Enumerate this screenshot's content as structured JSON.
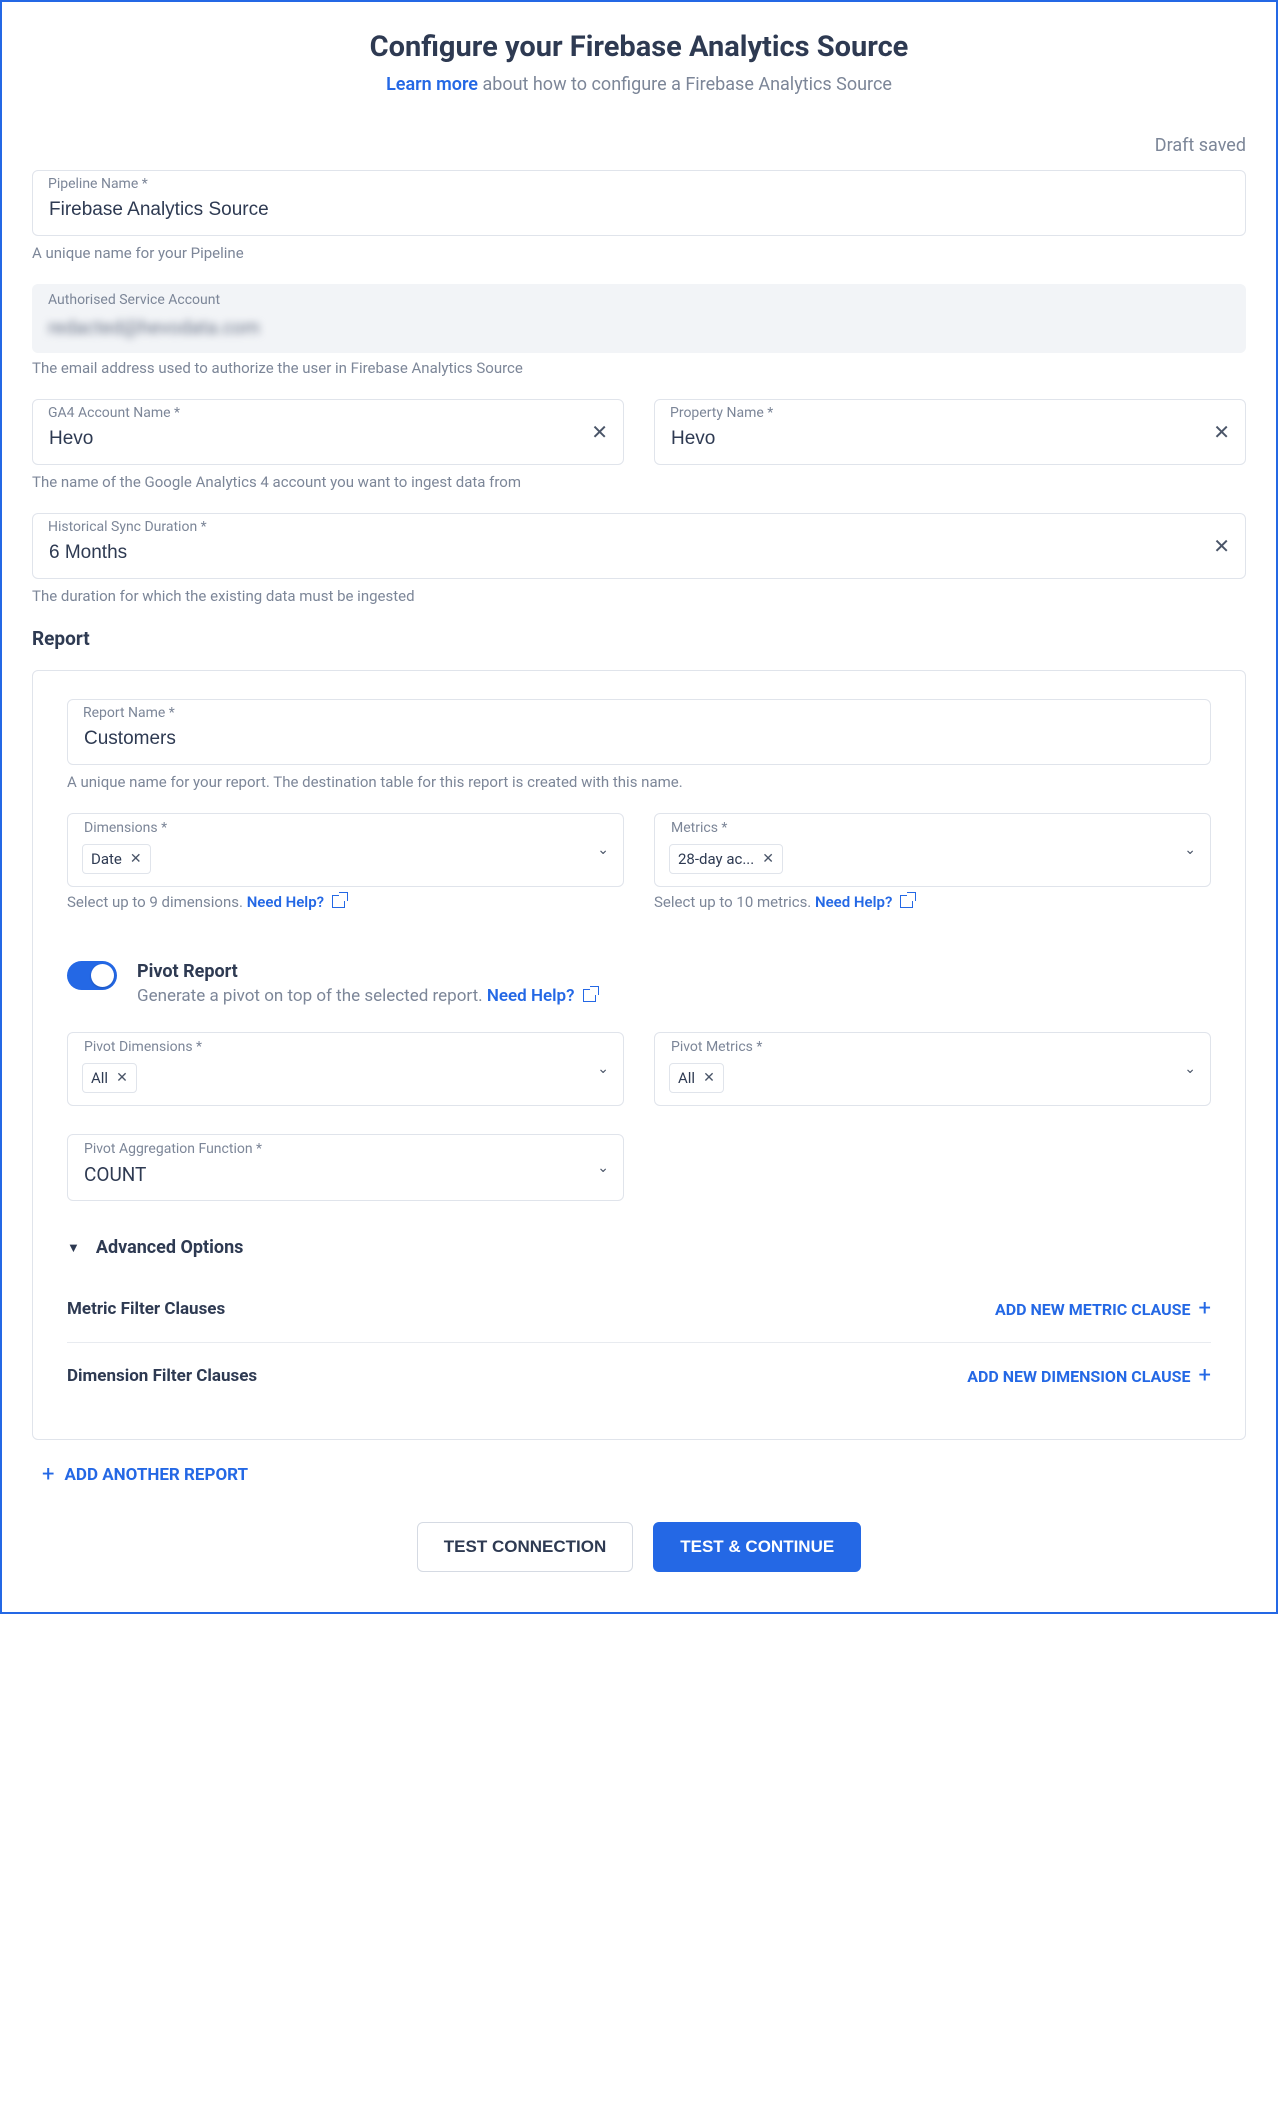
{
  "header": {
    "title": "Configure your Firebase Analytics Source",
    "learn_more": "Learn more",
    "subtitle_rest": " about how to configure a Firebase Analytics Source"
  },
  "status": "Draft saved",
  "fields": {
    "pipeline_name": {
      "label": "Pipeline Name *",
      "value": "Firebase Analytics Source",
      "helper": "A unique name for your Pipeline"
    },
    "service_account": {
      "label": "Authorised Service Account",
      "value": "redacted@hevodata.com",
      "helper": "The email address used to authorize the user in Firebase Analytics Source"
    },
    "ga4_account": {
      "label": "GA4 Account Name *",
      "value": "Hevo",
      "helper": "The name of the Google Analytics 4 account you want to ingest data from"
    },
    "property": {
      "label": "Property Name *",
      "value": "Hevo"
    },
    "sync_duration": {
      "label": "Historical Sync Duration *",
      "value": "6 Months",
      "helper": "The duration for which the existing data must be ingested"
    }
  },
  "report_section": "Report",
  "report": {
    "name": {
      "label": "Report Name *",
      "value": "Customers",
      "helper": "A unique name for your report. The destination table for this report is created with this name."
    },
    "dimensions": {
      "label": "Dimensions *",
      "chips": [
        "Date"
      ],
      "helper_pre": "Select up to 9 dimensions. ",
      "helper_link": "Need Help?"
    },
    "metrics": {
      "label": "Metrics *",
      "chips": [
        "28-day ac..."
      ],
      "helper_pre": "Select up to 10 metrics. ",
      "helper_link": "Need Help?"
    },
    "pivot": {
      "title": "Pivot Report",
      "desc_pre": "Generate a pivot on top of the selected report. ",
      "desc_link": "Need Help?",
      "dimensions": {
        "label": "Pivot Dimensions *",
        "chips": [
          "All"
        ]
      },
      "metrics": {
        "label": "Pivot Metrics *",
        "chips": [
          "All"
        ]
      },
      "agg": {
        "label": "Pivot Aggregation Function *",
        "value": "COUNT"
      }
    },
    "advanced": {
      "title": "Advanced Options",
      "metric_clauses": "Metric Filter Clauses",
      "add_metric": "ADD NEW METRIC CLAUSE",
      "dim_clauses": "Dimension Filter Clauses",
      "add_dim": "ADD NEW DIMENSION CLAUSE"
    }
  },
  "add_report": "ADD ANOTHER REPORT",
  "buttons": {
    "test": "TEST CONNECTION",
    "continue": "TEST & CONTINUE"
  }
}
